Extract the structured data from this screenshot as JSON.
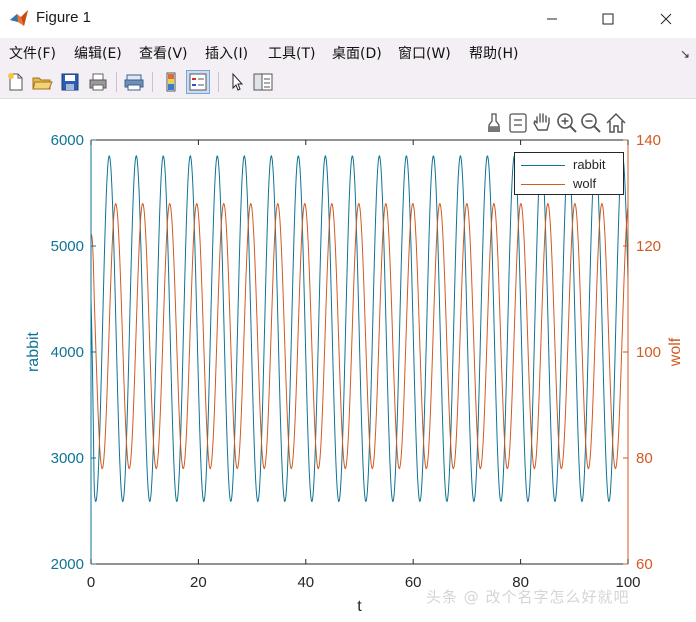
{
  "window": {
    "title": "Figure 1",
    "icon": "matlab-icon"
  },
  "menu": {
    "items": [
      "文件(F)",
      "编辑(E)",
      "查看(V)",
      "插入(I)",
      "工具(T)",
      "桌面(D)",
      "窗口(W)",
      "帮助(H)"
    ]
  },
  "toolbar": {
    "icons": [
      "new-figure-icon",
      "open-file-icon",
      "save-icon",
      "print-icon",
      "print-preview-icon",
      "colorbar-icon",
      "legend-icon",
      "pointer-icon",
      "property-inspector-icon"
    ]
  },
  "axes_toolbar": {
    "icons": [
      "data-brush-icon",
      "datatip-icon",
      "pan-hand-icon",
      "zoom-in-icon",
      "zoom-out-icon",
      "home-restore-icon"
    ]
  },
  "watermark": "头条 @ 改个名字怎么好就吧",
  "colors": {
    "rabbit": "#0f7395",
    "wolf": "#d15a22",
    "axis": "#262626"
  },
  "chart_data": {
    "type": "line",
    "xlabel": "t",
    "ylabel_left": "rabbit",
    "ylabel_right": "wolf",
    "xlim": [
      0,
      100
    ],
    "ylim_left": [
      2000,
      6000
    ],
    "ylim_right": [
      60,
      140
    ],
    "x_ticks": [
      0,
      20,
      40,
      60,
      80,
      100
    ],
    "y_ticks_left": [
      2000,
      3000,
      4000,
      5000,
      6000
    ],
    "y_ticks_right": [
      60,
      80,
      100,
      120,
      140
    ],
    "legend": [
      "rabbit",
      "wolf"
    ],
    "legend_position": "top-right",
    "grid": false,
    "series": [
      {
        "name": "rabbit",
        "axis": "left",
        "min": 2590,
        "max": 5850,
        "period": 5.03,
        "peak_t": 3.4,
        "start": 4500
      },
      {
        "name": "wolf",
        "axis": "right",
        "min": 78,
        "max": 128,
        "period": 5.03,
        "peak_t": 4.6,
        "start": 122
      }
    ]
  }
}
